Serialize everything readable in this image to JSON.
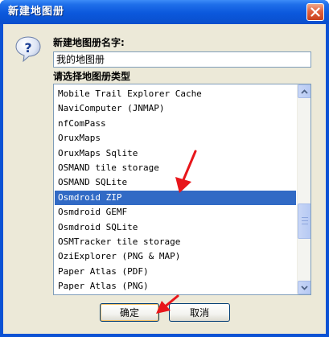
{
  "window": {
    "title": "新建地图册"
  },
  "form": {
    "name_label": "新建地图册名字:",
    "name_value": "我的地图册",
    "type_label": "请选择地图册类型"
  },
  "list": {
    "items": [
      "Mobile Trail Explorer Cache",
      "NaviComputer (JNMAP)",
      "nfComPass",
      "OruxMaps",
      "OruxMaps Sqlite",
      "OSMAND tile storage",
      "OSMAND SQLite",
      "Osmdroid ZIP",
      "Osmdroid GEMF",
      "Osmdroid SQLite",
      "OSMTracker tile storage",
      "OziExplorer  (PNG & MAP)",
      "Paper Atlas  (PDF)",
      "Paper Atlas  (PNG)"
    ],
    "selected": "Osmdroid ZIP"
  },
  "buttons": {
    "ok_label": "确定",
    "cancel_label": "取消"
  },
  "colors": {
    "selection": "#316ac5",
    "annotation_arrow": "#e8161b",
    "titlebar": "#0b58dc"
  },
  "icons": {
    "dialog": "question-icon",
    "close": "close-icon"
  }
}
